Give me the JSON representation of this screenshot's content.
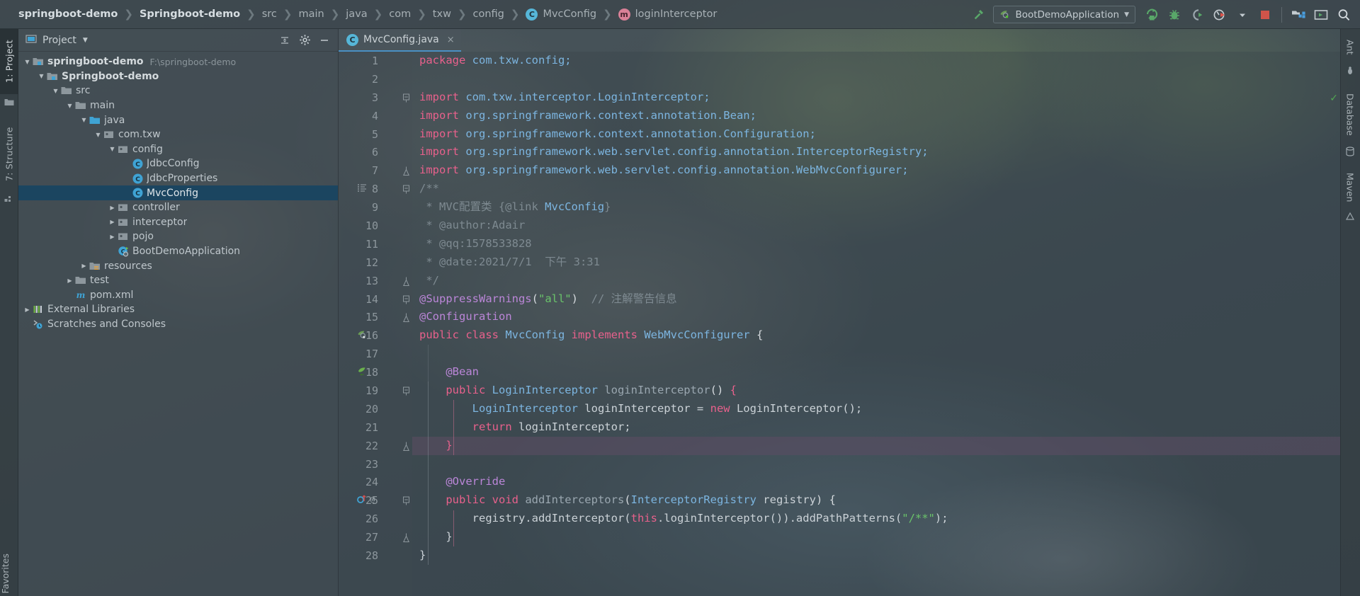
{
  "navbar": {
    "breadcrumbs": [
      {
        "label": "springboot-demo",
        "style": "bold",
        "icon": ""
      },
      {
        "label": "Springboot-demo",
        "style": "bold",
        "icon": ""
      },
      {
        "label": "src",
        "style": "normal",
        "icon": ""
      },
      {
        "label": "main",
        "style": "normal",
        "icon": ""
      },
      {
        "label": "java",
        "style": "normal",
        "icon": ""
      },
      {
        "label": "com",
        "style": "normal",
        "icon": ""
      },
      {
        "label": "txw",
        "style": "normal",
        "icon": ""
      },
      {
        "label": "config",
        "style": "normal",
        "icon": ""
      },
      {
        "label": "MvcConfig",
        "style": "normal",
        "icon": "class-badge"
      },
      {
        "label": "loginInterceptor",
        "style": "normal",
        "icon": "method-badge"
      }
    ],
    "separator": "❯",
    "run_config": {
      "label": "BootDemoApplication",
      "icon": "spring-boot-icon",
      "chevron": "▼"
    },
    "buttons": [
      {
        "name": "build-hammer-icon",
        "label": "Build"
      },
      {
        "name": "run-icon",
        "label": "Run"
      },
      {
        "name": "debug-icon",
        "label": "Debug"
      },
      {
        "name": "run-with-coverage-icon",
        "label": "Run with Coverage"
      },
      {
        "name": "profiler-icon",
        "label": "Profiler"
      },
      {
        "name": "profiler-dropdown-icon",
        "label": "More"
      },
      {
        "name": "stop-icon",
        "label": "Stop"
      },
      {
        "name": "project-structure-icon",
        "label": "Project Structure"
      },
      {
        "name": "terminal-icon",
        "label": "Terminal"
      },
      {
        "name": "search-everywhere-icon",
        "label": "Search Everywhere"
      }
    ]
  },
  "leftbar": {
    "tabs": [
      {
        "label": "1: Project",
        "active": true,
        "icon": "project-icon"
      },
      {
        "label": "7: Structure",
        "active": false,
        "icon": "structure-icon"
      }
    ],
    "bottom_label": "Favorites"
  },
  "rightbar": {
    "tabs": [
      {
        "label": "Ant",
        "icon": "ant-icon"
      },
      {
        "label": "Database",
        "icon": "database-icon"
      },
      {
        "label": "Maven",
        "icon": "maven-icon"
      }
    ]
  },
  "project_panel": {
    "title": "Project",
    "title_caret": "▼",
    "actions": [
      {
        "name": "collapse-all-icon",
        "label": "Collapse All"
      },
      {
        "name": "gear-icon",
        "label": "Settings"
      },
      {
        "name": "hide-icon",
        "label": "Hide"
      }
    ],
    "tree": [
      {
        "depth": 0,
        "arrow": "down",
        "icon": "module-folder",
        "label": "springboot-demo",
        "bold": true,
        "path": "F:\\springboot-demo",
        "selected": false
      },
      {
        "depth": 1,
        "arrow": "down",
        "icon": "module-folder",
        "label": "Springboot-demo",
        "bold": true,
        "path": "",
        "selected": false
      },
      {
        "depth": 2,
        "arrow": "down",
        "icon": "folder",
        "label": "src",
        "bold": false,
        "path": "",
        "selected": false
      },
      {
        "depth": 3,
        "arrow": "down",
        "icon": "folder",
        "label": "main",
        "bold": false,
        "path": "",
        "selected": false
      },
      {
        "depth": 4,
        "arrow": "down",
        "icon": "source-folder",
        "label": "java",
        "bold": false,
        "path": "",
        "selected": false
      },
      {
        "depth": 5,
        "arrow": "down",
        "icon": "package",
        "label": "com.txw",
        "bold": false,
        "path": "",
        "selected": false
      },
      {
        "depth": 6,
        "arrow": "down",
        "icon": "package",
        "label": "config",
        "bold": false,
        "path": "",
        "selected": false
      },
      {
        "depth": 7,
        "arrow": "none",
        "icon": "class",
        "label": "JdbcConfig",
        "bold": false,
        "path": "",
        "selected": false
      },
      {
        "depth": 7,
        "arrow": "none",
        "icon": "class",
        "label": "JdbcProperties",
        "bold": false,
        "path": "",
        "selected": false
      },
      {
        "depth": 7,
        "arrow": "none",
        "icon": "class",
        "label": "MvcConfig",
        "bold": false,
        "path": "",
        "selected": true
      },
      {
        "depth": 6,
        "arrow": "right",
        "icon": "package",
        "label": "controller",
        "bold": false,
        "path": "",
        "selected": false
      },
      {
        "depth": 6,
        "arrow": "right",
        "icon": "package",
        "label": "interceptor",
        "bold": false,
        "path": "",
        "selected": false
      },
      {
        "depth": 6,
        "arrow": "right",
        "icon": "package",
        "label": "pojo",
        "bold": false,
        "path": "",
        "selected": false
      },
      {
        "depth": 6,
        "arrow": "none",
        "icon": "spring-class",
        "label": "BootDemoApplication",
        "bold": false,
        "path": "",
        "selected": false
      },
      {
        "depth": 4,
        "arrow": "right",
        "icon": "resource-folder",
        "label": "resources",
        "bold": false,
        "path": "",
        "selected": false
      },
      {
        "depth": 3,
        "arrow": "right",
        "icon": "folder",
        "label": "test",
        "bold": false,
        "path": "",
        "selected": false
      },
      {
        "depth": 3,
        "arrow": "none",
        "icon": "maven-file",
        "label": "pom.xml",
        "bold": false,
        "path": "",
        "selected": false
      },
      {
        "depth": 0,
        "arrow": "right",
        "icon": "libraries",
        "label": "External Libraries",
        "bold": false,
        "path": "",
        "selected": false
      },
      {
        "depth": 0,
        "arrow": "none",
        "icon": "scratches",
        "label": "Scratches and Consoles",
        "bold": false,
        "path": "",
        "selected": false
      }
    ]
  },
  "editor": {
    "tab": {
      "label": "MvcConfig.java",
      "icon": "class-badge",
      "close": "×",
      "active": true
    },
    "inspection_status": "✓",
    "first_line": 1,
    "gutter_marks": [
      {
        "line": 8,
        "name": "javadoc-format-icon"
      },
      {
        "line": 16,
        "name": "spring-bean-gutter-icon"
      },
      {
        "line": 18,
        "name": "bean-method-gutter-icon"
      },
      {
        "line": 25,
        "name": "implementing-method-gutter-icon"
      },
      {
        "line": 25,
        "name": "override-annotation-gutter-icon"
      }
    ],
    "caret_line": 22,
    "lines": [
      {
        "n": 1,
        "tokens": [
          {
            "t": "package ",
            "c": "k"
          },
          {
            "t": "com.txw.config;",
            "c": "t"
          }
        ]
      },
      {
        "n": 2,
        "tokens": []
      },
      {
        "n": 3,
        "tokens": [
          {
            "t": "import ",
            "c": "k"
          },
          {
            "t": "com.txw.interceptor.LoginInterceptor;",
            "c": "t"
          }
        ],
        "fold": "start"
      },
      {
        "n": 4,
        "tokens": [
          {
            "t": "import ",
            "c": "k"
          },
          {
            "t": "org.springframework.context.annotation.",
            "c": "t"
          },
          {
            "t": "Bean",
            "c": "t"
          },
          {
            "t": ";",
            "c": "t"
          }
        ]
      },
      {
        "n": 5,
        "tokens": [
          {
            "t": "import ",
            "c": "k"
          },
          {
            "t": "org.springframework.context.annotation.",
            "c": "t"
          },
          {
            "t": "Configuration",
            "c": "t"
          },
          {
            "t": ";",
            "c": "t"
          }
        ]
      },
      {
        "n": 6,
        "tokens": [
          {
            "t": "import ",
            "c": "k"
          },
          {
            "t": "org.springframework.web.servlet.config.annotation.",
            "c": "t"
          },
          {
            "t": "InterceptorRegistry",
            "c": "t"
          },
          {
            "t": ";",
            "c": "t"
          }
        ]
      },
      {
        "n": 7,
        "tokens": [
          {
            "t": "import ",
            "c": "k"
          },
          {
            "t": "org.springframework.web.servlet.config.annotation.",
            "c": "t"
          },
          {
            "t": "WebMvcConfigurer",
            "c": "t"
          },
          {
            "t": ";",
            "c": "t"
          }
        ],
        "fold": "end"
      },
      {
        "n": 8,
        "tokens": [
          {
            "t": "/**",
            "c": "cm"
          }
        ],
        "fold": "start"
      },
      {
        "n": 9,
        "tokens": [
          {
            "t": " * ",
            "c": "cm"
          },
          {
            "t": "MVC配置类 ",
            "c": "cm"
          },
          {
            "t": "{@link ",
            "c": "cm"
          },
          {
            "t": "MvcConfig",
            "c": "lk"
          },
          {
            "t": "}",
            "c": "cm"
          }
        ]
      },
      {
        "n": 10,
        "tokens": [
          {
            "t": " * @author:Adair",
            "c": "cm"
          }
        ]
      },
      {
        "n": 11,
        "tokens": [
          {
            "t": " * @qq:1578533828",
            "c": "cm"
          }
        ]
      },
      {
        "n": 12,
        "tokens": [
          {
            "t": " * @date:2021/7/1  下午 3:31",
            "c": "cm"
          }
        ]
      },
      {
        "n": 13,
        "tokens": [
          {
            "t": " */",
            "c": "cm"
          }
        ],
        "fold": "end"
      },
      {
        "n": 14,
        "tokens": [
          {
            "t": "@SuppressWarnings",
            "c": "an"
          },
          {
            "t": "(",
            "c": "br"
          },
          {
            "t": "\"all\"",
            "c": "s"
          },
          {
            "t": ")",
            "c": "br"
          },
          {
            "t": "  // 注解警告信息",
            "c": "cm"
          }
        ],
        "fold": "start"
      },
      {
        "n": 15,
        "tokens": [
          {
            "t": "@Configuration",
            "c": "an"
          }
        ],
        "fold": "end"
      },
      {
        "n": 16,
        "tokens": [
          {
            "t": "public class ",
            "c": "k"
          },
          {
            "t": "MvcConfig ",
            "c": "t"
          },
          {
            "t": "implements ",
            "c": "k"
          },
          {
            "t": "WebMvcConfigurer ",
            "c": "t"
          },
          {
            "t": "{",
            "c": "br"
          }
        ]
      },
      {
        "n": 17,
        "tokens": []
      },
      {
        "n": 18,
        "tokens": [
          {
            "t": "    @Bean",
            "c": "an"
          }
        ]
      },
      {
        "n": 19,
        "tokens": [
          {
            "t": "    public ",
            "c": "k"
          },
          {
            "t": "LoginInterceptor ",
            "c": "t"
          },
          {
            "t": "loginInterceptor",
            "c": "i"
          },
          {
            "t": "() ",
            "c": "br"
          },
          {
            "t": "{",
            "c": "k"
          }
        ],
        "fold": "start"
      },
      {
        "n": 20,
        "tokens": [
          {
            "t": "        ",
            "c": "pl"
          },
          {
            "t": "LoginInterceptor ",
            "c": "t"
          },
          {
            "t": "loginInterceptor = ",
            "c": "pl"
          },
          {
            "t": "new ",
            "c": "k"
          },
          {
            "t": "LoginInterceptor();",
            "c": "pl"
          }
        ]
      },
      {
        "n": 21,
        "tokens": [
          {
            "t": "        ",
            "c": "pl"
          },
          {
            "t": "return ",
            "c": "k"
          },
          {
            "t": "loginInterceptor;",
            "c": "pl"
          }
        ]
      },
      {
        "n": 22,
        "tokens": [
          {
            "t": "    ",
            "c": "pl"
          },
          {
            "t": "}",
            "c": "k"
          }
        ],
        "fold": "end"
      },
      {
        "n": 23,
        "tokens": []
      },
      {
        "n": 24,
        "tokens": [
          {
            "t": "    @Override",
            "c": "an"
          }
        ]
      },
      {
        "n": 25,
        "tokens": [
          {
            "t": "    public void ",
            "c": "k"
          },
          {
            "t": "addInterceptors",
            "c": "i"
          },
          {
            "t": "(",
            "c": "br"
          },
          {
            "t": "InterceptorRegistry ",
            "c": "t"
          },
          {
            "t": "registry",
            "c": "pl"
          },
          {
            "t": ") {",
            "c": "br"
          }
        ],
        "fold": "start"
      },
      {
        "n": 26,
        "tokens": [
          {
            "t": "        registry.addInterceptor(",
            "c": "pl"
          },
          {
            "t": "this",
            "c": "k"
          },
          {
            "t": ".loginInterceptor()).addPathPatterns(",
            "c": "pl"
          },
          {
            "t": "\"/**\"",
            "c": "s"
          },
          {
            "t": ");",
            "c": "pl"
          }
        ]
      },
      {
        "n": 27,
        "tokens": [
          {
            "t": "    }",
            "c": "pl"
          }
        ],
        "fold": "end"
      },
      {
        "n": 28,
        "tokens": [
          {
            "t": "}",
            "c": "pl"
          }
        ]
      }
    ]
  },
  "colors": {
    "accent_blue": "#4a90c4",
    "selection_blue": "#1b4560",
    "keyword_pink": "#e8618c",
    "type_blue": "#7cb5e0",
    "string_green": "#6ac36a",
    "comment_grey": "#7e8a91",
    "annotation_purple": "#bb86d8",
    "caret_line": "#5d4d64",
    "stop_red": "#d0544a",
    "run_green": "#59a869"
  }
}
